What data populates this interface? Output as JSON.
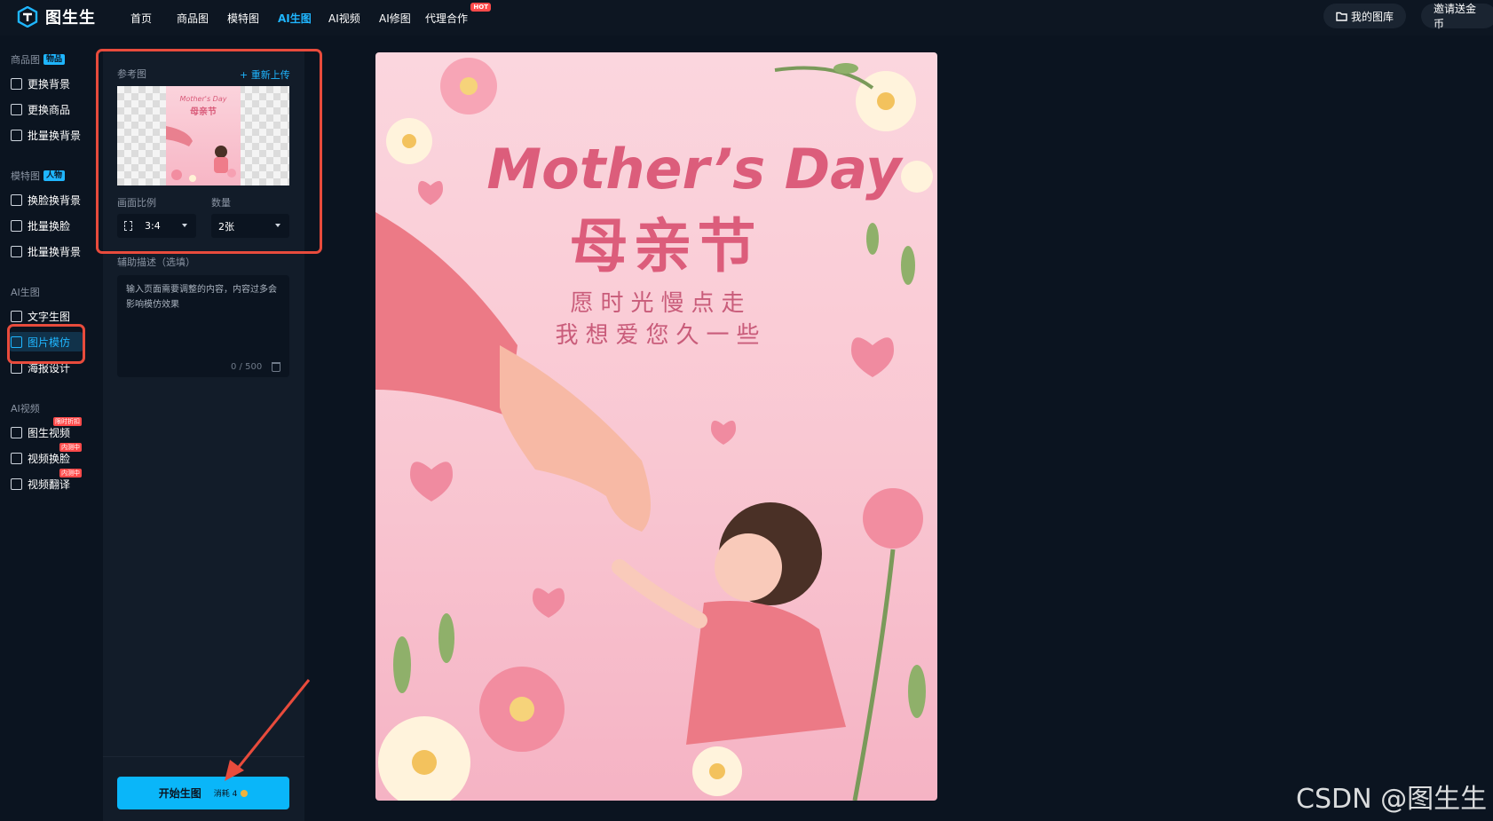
{
  "app": {
    "name": "图生生"
  },
  "nav": {
    "items": [
      "首页",
      "商品图",
      "模特图",
      "AI生图",
      "AI视频",
      "AI修图",
      "代理合作"
    ],
    "active": "AI生图",
    "hot_badge": "HOT"
  },
  "top_right": {
    "gallery": "我的图库",
    "invite": "邀请送金币"
  },
  "sidebar": {
    "sections": [
      {
        "title": "商品图",
        "tag": "物品",
        "items": [
          {
            "label": "更换背景"
          },
          {
            "label": "更换商品"
          },
          {
            "label": "批量换背景"
          }
        ]
      },
      {
        "title": "模特图",
        "tag": "人物",
        "items": [
          {
            "label": "换脸换背景"
          },
          {
            "label": "批量换脸"
          },
          {
            "label": "批量换背景"
          }
        ]
      },
      {
        "title": "AI生图",
        "tag": "",
        "items": [
          {
            "label": "文字生图"
          },
          {
            "label": "图片模仿"
          },
          {
            "label": "海报设计"
          }
        ]
      },
      {
        "title": "AI视频",
        "tag": "",
        "items": [
          {
            "label": "图生视频",
            "badge": "限时折扣"
          },
          {
            "label": "视频换脸",
            "badge": "内测中"
          },
          {
            "label": "视频翻译",
            "badge": "内测中"
          }
        ]
      }
    ],
    "active_item": "图片模仿"
  },
  "panel": {
    "reference_label": "参考图",
    "reupload": "+ 重新上传",
    "ratio_label": "画面比例",
    "ratio_value": "3:4",
    "count_label": "数量",
    "count_value": "2张",
    "desc_label": "辅助描述（选填）",
    "desc_placeholder": "输入页面需要调整的内容，内容过多会影响模仿效果",
    "char_count": "0 / 500",
    "start_button": "开始生图",
    "cost_label": "消耗 4"
  },
  "thumbnail": {
    "title_en": "Mother's Day",
    "title_cn": "母亲节"
  },
  "poster": {
    "title_en": "Mother’s Day",
    "title_cn": "母亲节",
    "line1": "愿时光慢点走",
    "line2": "我想爱您久一些"
  },
  "watermark": "CSDN @图生生",
  "colors": {
    "accent": "#1fb6ff",
    "start_button": "#0ab6f9",
    "highlight_box": "#e84b3c",
    "poster_text": "#dc5d7b",
    "hot": "#ff4a4a"
  }
}
